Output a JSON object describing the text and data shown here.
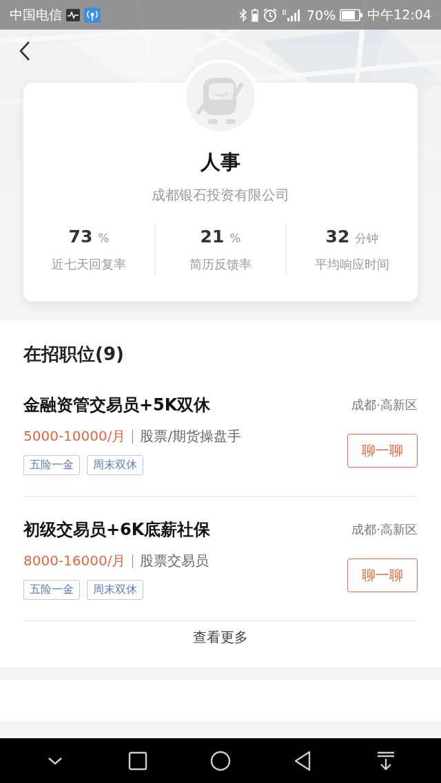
{
  "status_bar": {
    "carrier": "中国电信",
    "battery": "70%",
    "time": "中午12:04"
  },
  "profile": {
    "name": "人事",
    "company": "成都银石投资有限公司",
    "stats": [
      {
        "value": "73",
        "unit": "%",
        "label": "近七天回复率"
      },
      {
        "value": "21",
        "unit": "%",
        "label": "简历反馈率"
      },
      {
        "value": "32",
        "unit": "分钟",
        "label": "平均响应时间"
      }
    ]
  },
  "jobs": {
    "title": "在招职位(9)",
    "items": [
      {
        "title": "金融资管交易员+5K双休",
        "location": "成都·高新区",
        "salary": "5000-10000/月",
        "category": "股票/期货操盘手",
        "tags": [
          "五险一金",
          "周末双休"
        ],
        "action": "聊一聊"
      },
      {
        "title": "初级交易员+6K底薪社保",
        "location": "成都·高新区",
        "salary": "8000-16000/月",
        "category": "股票交易员",
        "tags": [
          "五险一金",
          "周末双休"
        ],
        "action": "聊一聊"
      }
    ],
    "more": "查看更多"
  }
}
